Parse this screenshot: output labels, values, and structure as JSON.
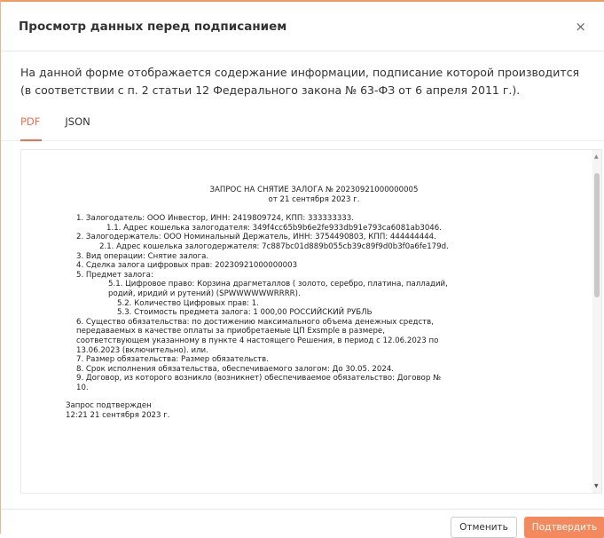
{
  "modal": {
    "title": "Просмотр данных перед подписанием",
    "close_symbol": "×",
    "description": "На данной форме отображается содержание информации, подписание которой производится (в соответствии с п. 2 статьи 12 Федерального закона № 63-ФЗ от 6 апреля 2011 г.).",
    "tabs": [
      {
        "label": "PDF",
        "active": true
      },
      {
        "label": "JSON",
        "active": false
      }
    ]
  },
  "document": {
    "title_line1": "ЗАПРОС НА СНЯТИЕ ЗАЛОГА № 20230921000000005",
    "title_line2": "от 21 сентября 2023 г.",
    "lines": [
      "1. Залогодатель: ООО Инвестор, ИНН: 2419809724, КПП: 333333333.",
      "1.1. Адрес кошелька залогодателя: 349f4cc65b9b6e2fe933db91e793ca6081ab3046.",
      "2. Залогодержатель: ООО Номинальный Держатель, ИНН: 3754490803, КПП: 444444444.",
      "2.1. Адрес кошелька залогодержателя: 7c887bc01d889b055cb39c89f9d0b3f0a6fe179d.",
      "3. Вид операции: Снятие залога.",
      "4. Сделка залога цифровых прав: 20230921000000003",
      "5. Предмет залога:",
      "5.1. Цифровое право: Корзина драгметаллов ( золото, серебро, платина, палладий,",
      "родий, иридий и рутений) (SPWWWWWWRRRR).",
      "5.2. Количество Цифровых прав: 1.",
      "5.3. Стоимость предмета залога: 1 000,00 РОССИЙСКИЙ РУБЛЬ",
      "6. Существо обязательства: по достижению максимального объема денежных средств,",
      "передаваемых в качестве оплаты за приобретаемые ЦП Exsmple в размере,",
      "соответствующем указанному в пункте 4 настоящего Решения, в период с 12.06.2023 по",
      "13.06.2023 (включительно). или.",
      "7. Размер обязательства: Размер обязательств.",
      "8. Срок исполнения обязательства, обеспечиваемого залогом: До 30.05. 2024.",
      "9. Договор, из которого возникло (возникнет) обеспечиваемое обязательство: Договор №",
      "10."
    ],
    "confirm_line1": "Запрос подтвержден",
    "confirm_line2": "12:21 21 сентября 2023 г."
  },
  "footer": {
    "cancel_label": "Отменить",
    "confirm_label": "Подтвердить"
  },
  "colors": {
    "accent": "#f0704b",
    "confirm_button": "#f5895e"
  }
}
